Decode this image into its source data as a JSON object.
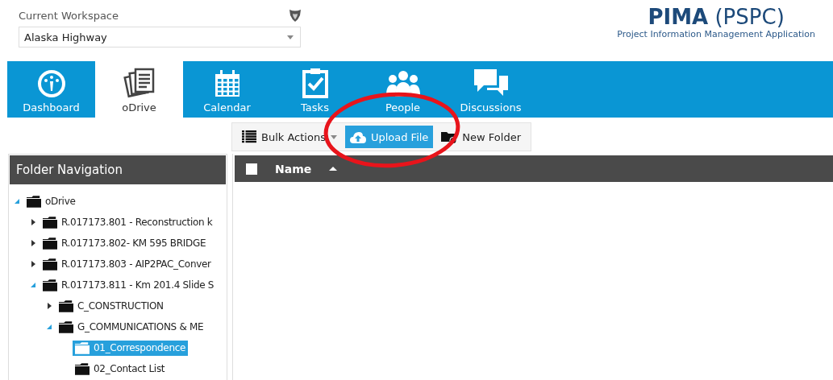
{
  "workspace": {
    "label": "Current Workspace",
    "value": "Alaska Highway"
  },
  "logo": {
    "name": "PIMA",
    "suffix": "(PSPC)",
    "subtitle": "Project Information Management Application"
  },
  "tabs": [
    {
      "label": "Dashboard",
      "kind": "dashboard",
      "selected": false
    },
    {
      "label": "oDrive",
      "kind": "odrive",
      "selected": true
    },
    {
      "label": "Calendar",
      "kind": "calendar",
      "selected": false
    },
    {
      "label": "Tasks",
      "kind": "tasks",
      "selected": false
    },
    {
      "label": "People",
      "kind": "people",
      "selected": false
    },
    {
      "label": "Discussions",
      "kind": "discussions",
      "selected": false
    }
  ],
  "toolbar": [
    {
      "label": "Bulk Actions",
      "kind": "bulk"
    },
    {
      "label": "Upload File",
      "kind": "upload"
    },
    {
      "label": "New Folder",
      "kind": "newfolder"
    }
  ],
  "folder_navigation": {
    "title": "Folder Navigation",
    "tree": [
      {
        "label": "oDrive",
        "expanded": true,
        "selected": false,
        "children": [
          {
            "label": "R.017173.801 - Reconstruction k",
            "expanded": false,
            "selected": false
          },
          {
            "label": "R.017173.802- KM 595 BRIDGE",
            "expanded": false,
            "selected": false
          },
          {
            "label": "R.017173.803 - AIP2PAC_Conver",
            "expanded": false,
            "selected": false
          },
          {
            "label": "R.017173.811 - Km 201.4 Slide S",
            "expanded": true,
            "selected": false,
            "children": [
              {
                "label": "C_CONSTRUCTION",
                "expanded": false,
                "selected": false
              },
              {
                "label": "G_COMMUNICATIONS & ME",
                "expanded": true,
                "selected": false,
                "children": [
                  {
                    "label": "01_Correspondence",
                    "selected": true
                  },
                  {
                    "label": "02_Contact List",
                    "selected": false
                  }
                ]
              }
            ]
          }
        ]
      }
    ]
  },
  "file_list": {
    "columns": [
      {
        "label": "Name",
        "sort_ascending": true
      }
    ],
    "select_all_checked": false
  }
}
